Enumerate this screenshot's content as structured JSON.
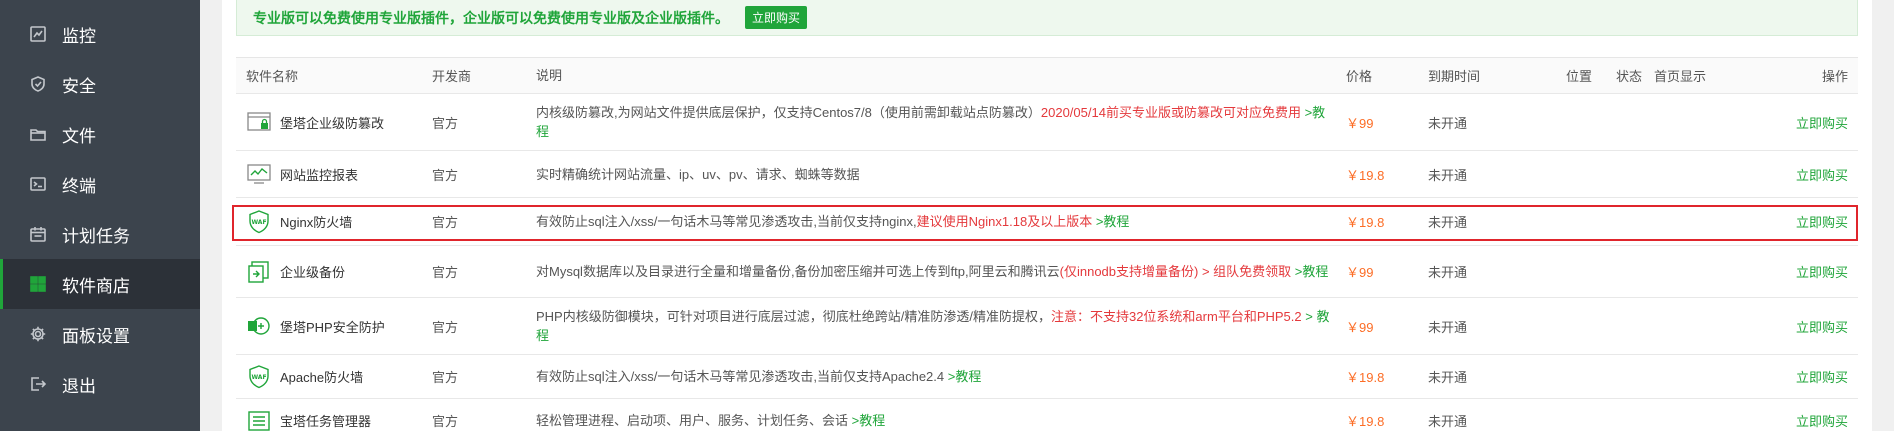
{
  "sidebar": {
    "items": [
      {
        "label": "监控",
        "icon": "monitor-icon",
        "active": false
      },
      {
        "label": "安全",
        "icon": "shield-icon",
        "active": false
      },
      {
        "label": "文件",
        "icon": "folder-icon",
        "active": false
      },
      {
        "label": "终端",
        "icon": "terminal-icon",
        "active": false
      },
      {
        "label": "计划任务",
        "icon": "calendar-icon",
        "active": false
      },
      {
        "label": "软件商店",
        "icon": "grid-icon",
        "active": true
      },
      {
        "label": "面板设置",
        "icon": "gear-icon",
        "active": false
      },
      {
        "label": "退出",
        "icon": "logout-icon",
        "active": false
      }
    ]
  },
  "promo": {
    "text": "专业版可以免费使用专业版插件，企业版可以免费使用专业版及企业版插件。",
    "buy_label": "立即购买"
  },
  "colors": {
    "accent": "#20a53a",
    "warning": "#e4393c",
    "price": "#fc6d26",
    "highlight": "#e0252c"
  },
  "table": {
    "headers": {
      "name": "软件名称",
      "developer": "开发商",
      "description": "说明",
      "price": "价格",
      "expire": "到期时间",
      "position": "位置",
      "status": "状态",
      "homepage": "首页显示",
      "action": "操作"
    },
    "rows": [
      {
        "name": "堡塔企业级防篡改",
        "icon": "tamper-protect-icon",
        "developer": "官方",
        "desc_normal": "内核级防篡改,为网站文件提供底层保护，仅支持Centos7/8（使用前需卸载站点防篡改）",
        "desc_red": "2020/05/14前买专业版或防篡改可对应免费用",
        "desc_link": " >教程",
        "price": "￥99",
        "expire": "未开通",
        "action": "立即购买"
      },
      {
        "name": "网站监控报表",
        "icon": "site-monitor-icon",
        "developer": "官方",
        "desc_normal": "实时精确统计网站流量、ip、uv、pv、请求、蜘蛛等数据",
        "desc_red": "",
        "desc_link": "",
        "price": "￥19.8",
        "expire": "未开通",
        "action": "立即购买"
      },
      {
        "name": "Nginx防火墙",
        "icon": "waf-shield-icon",
        "developer": "官方",
        "desc_normal": "有效防止sql注入/xss/一句话木马等常见渗透攻击,当前仅支持nginx,",
        "desc_red": "建议使用Nginx1.18及以上版本",
        "desc_link": " >教程",
        "price": "￥19.8",
        "expire": "未开通",
        "action": "立即购买"
      },
      {
        "name": "企业级备份",
        "icon": "backup-icon",
        "developer": "官方",
        "desc_normal": "对Mysql数据库以及目录进行全量和增量备份,备份加密压缩并可选上传到ftp,阿里云和腾讯云",
        "desc_red": "(仅innodb支持增量备份) > 组队免费领取",
        "desc_link": " >教程",
        "price": "￥99",
        "expire": "未开通",
        "action": "立即购买"
      },
      {
        "name": "堡塔PHP安全防护",
        "icon": "php-shield-icon",
        "developer": "官方",
        "desc_normal": "PHP内核级防御模块，可针对项目进行底层过滤，彻底杜绝跨站/精准防渗透/精准防提权，",
        "desc_red": "注意：不支持32位系统和arm平台和PHP5.2",
        "desc_link": " > 教程",
        "price": "￥99",
        "expire": "未开通",
        "action": "立即购买"
      },
      {
        "name": "Apache防火墙",
        "icon": "waf-shield-icon",
        "developer": "官方",
        "desc_normal": "有效防止sql注入/xss/一句话木马等常见渗透攻击,当前仅支持Apache2.4",
        "desc_red": "",
        "desc_link": " >教程",
        "price": "￥19.8",
        "expire": "未开通",
        "action": "立即购买"
      },
      {
        "name": "宝塔任务管理器",
        "icon": "task-manager-icon",
        "developer": "官方",
        "desc_normal": "轻松管理进程、启动项、用户、服务、计划任务、会话",
        "desc_red": "",
        "desc_link": " >教程",
        "price": "￥19.8",
        "expire": "未开通",
        "action": "立即购买"
      }
    ]
  }
}
